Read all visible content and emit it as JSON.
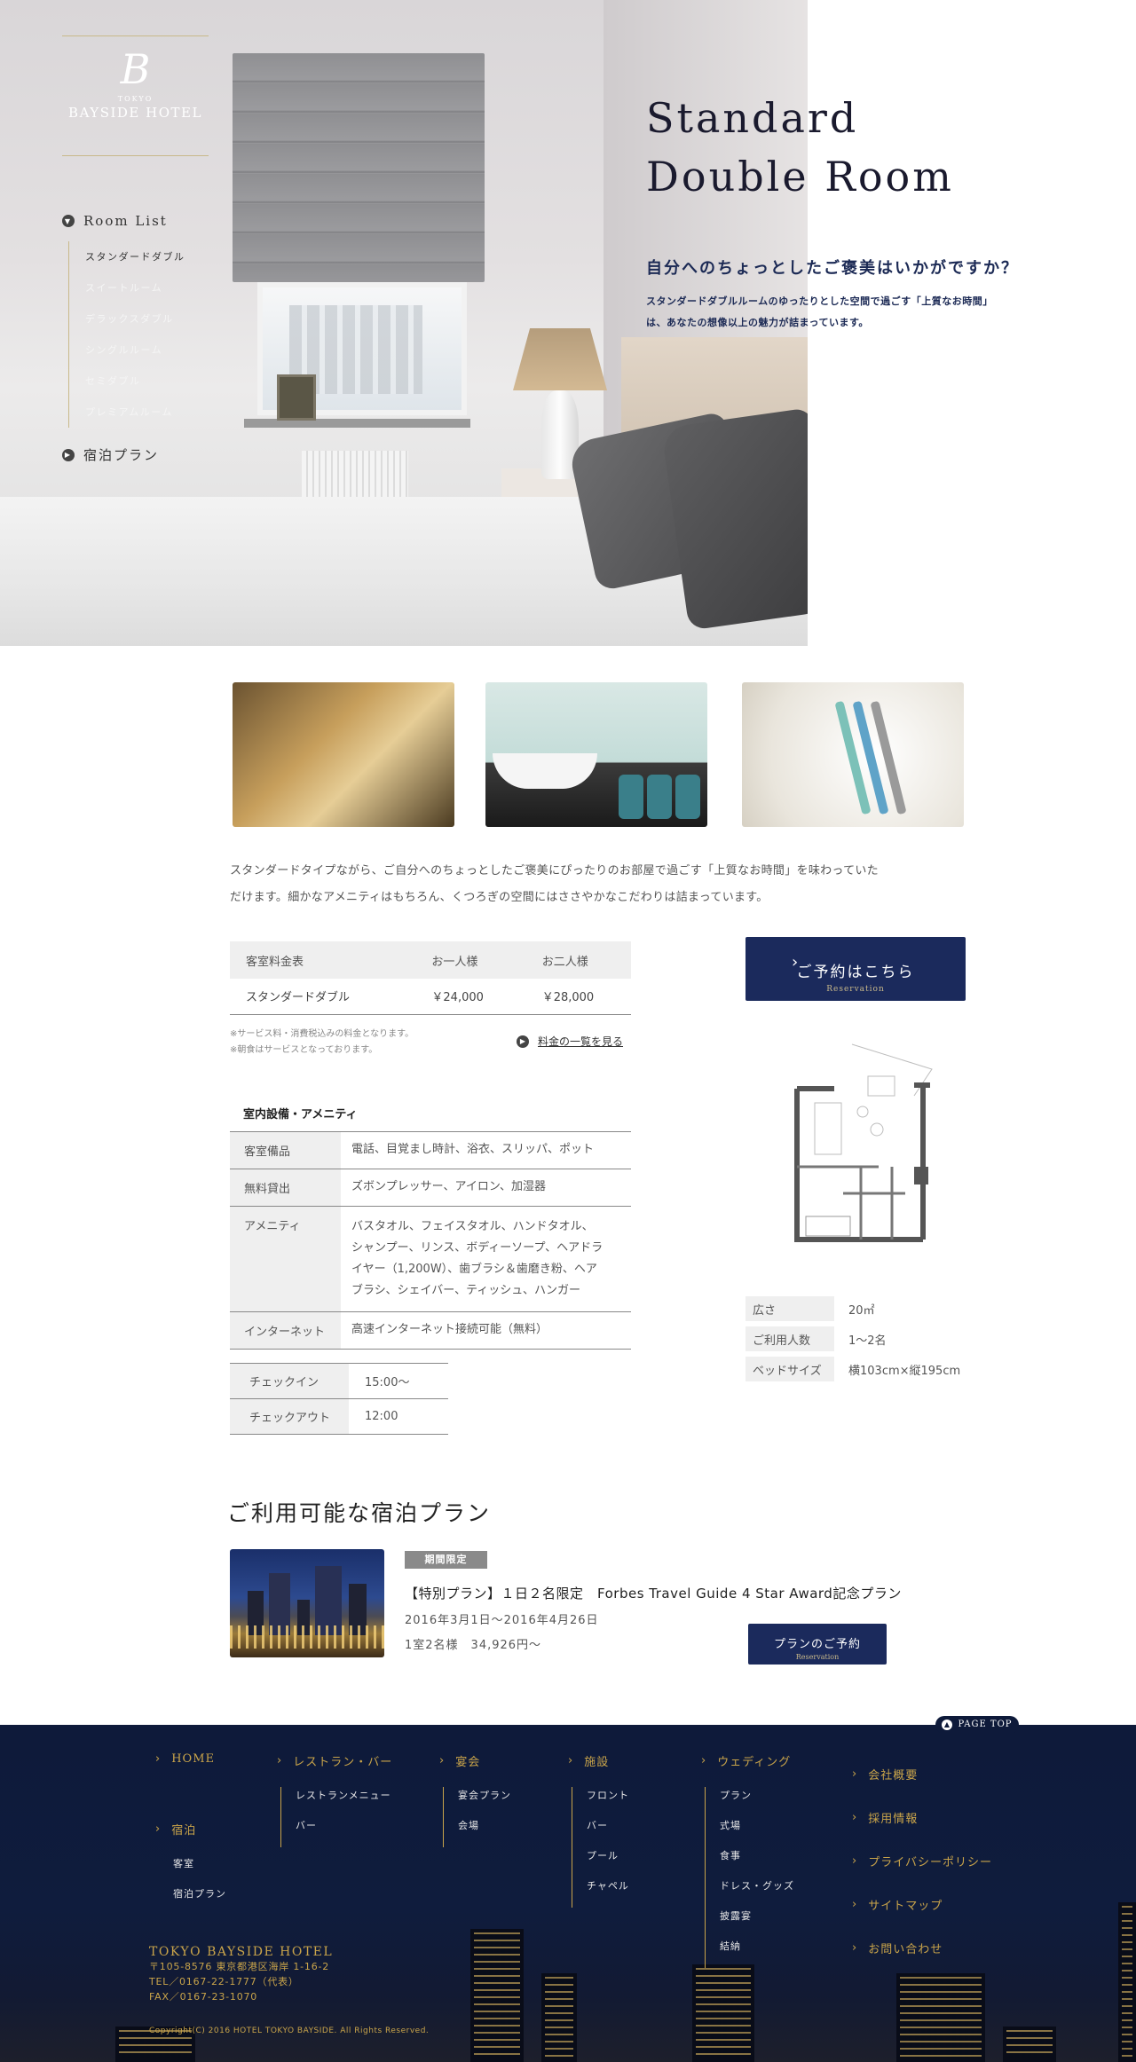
{
  "brand": {
    "logo_mark": "B",
    "logo_small": "TOKYO",
    "logo_name": "BAYSIDE HOTEL"
  },
  "sidenav": {
    "heading": "Room List",
    "rooms": [
      "スタンダードダブル",
      "スイートルーム",
      "デラックスダブル",
      "シングルルーム",
      "セミダブル",
      "プレミアムルーム"
    ],
    "active_index": 0,
    "plan_link": "宿泊プラン"
  },
  "hero": {
    "title_line1": "Standard",
    "title_line2": "Double Room",
    "lead": "自分へのちょっとしたご褒美はいかがですか？",
    "desc_line1": "スタンダードダブルルームのゆったりとした空間で過ごす「上質なお時間」",
    "desc_line2": "は、あなたの想像以上の魅力が詰まっています。"
  },
  "intro": {
    "line1": "スタンダードタイプながら、ご自分へのちょっとしたご褒美にぴったりのお部屋で過ごす「上質なお時間」を味わっていた",
    "line2": "だけます。細かなアメニティはもちろん、くつろぎの空間にはささやかなこだわりは詰まっています。"
  },
  "price_table": {
    "headers": [
      "客室料金表",
      "お一人様",
      "お二人様"
    ],
    "row": [
      "スタンダードダブル",
      "￥24,000",
      "￥28,000"
    ],
    "note1": "※サービス料・消費税込みの料金となります。",
    "note2": "※朝食はサービスとなっております。",
    "link": "料金の一覧を見る"
  },
  "reserve": {
    "label": "ご予約はこちら",
    "sub": "Reservation"
  },
  "amenity": {
    "title": "室内設備・アメニティ",
    "rows": [
      {
        "label": "客室備品",
        "value": "電話、目覚まし時計、浴衣、スリッパ、ポット"
      },
      {
        "label": "無料貸出",
        "value": "ズボンプレッサー、アイロン、加湿器"
      },
      {
        "label": "アメニティ",
        "value_lines": [
          "バスタオル、フェイスタオル、ハンドタオル、",
          "シャンプー、リンス、ボディーソープ、ヘアドラ",
          "イヤー（1,200W）、歯ブラシ＆歯磨き粉、ヘア",
          "ブラシ、シェイバー、ティッシュ、ハンガー"
        ]
      },
      {
        "label": "インターネット",
        "value": "高速インターネット接続可能（無料）"
      }
    ]
  },
  "checkinout": [
    {
      "label": "チェックイン",
      "value": "15:00〜"
    },
    {
      "label": "チェックアウト",
      "value": "12:00"
    }
  ],
  "spec": [
    {
      "label": "広さ",
      "value": "20㎡"
    },
    {
      "label": "ご利用人数",
      "value": "1〜2名"
    },
    {
      "label": "ベッドサイズ",
      "value": "横103cm×縦195cm"
    }
  ],
  "plans": {
    "title": "ご利用可能な宿泊プラン",
    "item": {
      "badge": "期間限定",
      "name": "【特別プラン】１日２名限定　Forbes Travel Guide 4 Star Award記念プラン",
      "date": "2016年3月1日〜2016年4月26日",
      "price": "1室2名様　34,926円〜",
      "button": "プランのご予約",
      "button_sub": "Reservation"
    }
  },
  "pagetop": "PAGE TOP",
  "footer": {
    "col1": [
      {
        "head": "HOME",
        "items": []
      },
      {
        "head": "宿泊",
        "items": [
          "客室",
          "宿泊プラン"
        ]
      }
    ],
    "col2": {
      "head": "レストラン・バー",
      "items": [
        "レストランメニュー",
        "バー"
      ]
    },
    "col3": {
      "head": "宴会",
      "items": [
        "宴会プラン",
        "会場"
      ]
    },
    "col4": {
      "head": "施設",
      "items": [
        "フロント",
        "バー",
        "プール",
        "チャペル"
      ]
    },
    "col5": {
      "head": "ウェディング",
      "items": [
        "プラン",
        "式場",
        "食事",
        "ドレス・グッズ",
        "披露宴",
        "結納"
      ]
    },
    "col6": [
      "会社概要",
      "採用情報",
      "プライバシーポリシー",
      "サイトマップ",
      "お問い合わせ"
    ],
    "company": "TOKYO BAYSIDE HOTEL",
    "address": "〒105-8576 東京都港区海岸 1-16-2",
    "tel": "TEL／0167-22-1777（代表）",
    "fax": "FAX／0167-23-1070",
    "copyright": "Copyright(C) 2016 HOTEL TOKYO BAYSIDE. All Rights Reserved."
  },
  "colors": {
    "navy": "#1b2a5c",
    "gold": "#c9a44a",
    "footer_bg": "#0e1a3a"
  }
}
